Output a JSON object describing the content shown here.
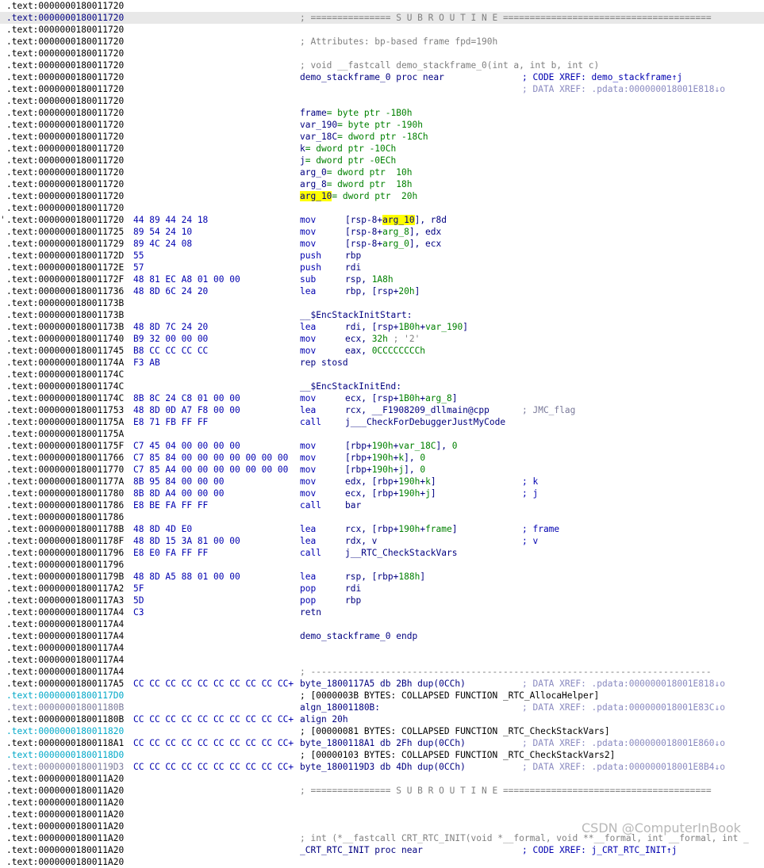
{
  "watermark": "CSDN @ComputerInBook",
  "lines": [
    {
      "addr": ".text:0000000180011720"
    },
    {
      "addr": ".text:0000000180011720",
      "addr_color": "navy",
      "highlight": true,
      "ins": [
        {
          "t": "; =============== S U B R O U T I N E =======================================",
          "c": "gray"
        }
      ]
    },
    {
      "addr": ".text:0000000180011720"
    },
    {
      "addr": ".text:0000000180011720",
      "ins": [
        {
          "t": "; Attributes: bp-based frame fpd=190h",
          "c": "gray"
        }
      ]
    },
    {
      "addr": ".text:0000000180011720"
    },
    {
      "addr": ".text:0000000180011720",
      "ins": [
        {
          "t": "; void __fastcall demo_stackframe_0(int a, int b, int c)",
          "c": "gray"
        }
      ]
    },
    {
      "addr": ".text:0000000180011720",
      "ins": [
        {
          "t": "demo_stackframe_0 proc near",
          "c": "navy"
        }
      ],
      "cmt": [
        {
          "t": "; CODE XREF: demo_stackframe↑j",
          "c": "blue"
        }
      ]
    },
    {
      "addr": ".text:0000000180011720",
      "cmt": [
        {
          "t": "; DATA XREF: .pdata:000000018001E818↓o",
          "c": "xref"
        }
      ]
    },
    {
      "addr": ".text:0000000180011720"
    },
    {
      "addr": ".text:0000000180011720",
      "ins": [
        {
          "t": "frame",
          "c": "navy"
        },
        {
          "t": "= byte ptr -1B0h",
          "c": "grn"
        }
      ]
    },
    {
      "addr": ".text:0000000180011720",
      "ins": [
        {
          "t": "var_190",
          "c": "navy"
        },
        {
          "t": "= byte ptr -190h",
          "c": "grn"
        }
      ]
    },
    {
      "addr": ".text:0000000180011720",
      "ins": [
        {
          "t": "var_18C",
          "c": "navy"
        },
        {
          "t": "= dword ptr -18Ch",
          "c": "grn"
        }
      ]
    },
    {
      "addr": ".text:0000000180011720",
      "ins": [
        {
          "t": "k",
          "c": "navy"
        },
        {
          "t": "= dword ptr -10Ch",
          "c": "grn"
        }
      ]
    },
    {
      "addr": ".text:0000000180011720",
      "ins": [
        {
          "t": "j",
          "c": "navy"
        },
        {
          "t": "= dword ptr -0ECh",
          "c": "grn"
        }
      ]
    },
    {
      "addr": ".text:0000000180011720",
      "ins": [
        {
          "t": "arg_0",
          "c": "navy"
        },
        {
          "t": "= dword ptr  10h",
          "c": "grn"
        }
      ]
    },
    {
      "addr": ".text:0000000180011720",
      "ins": [
        {
          "t": "arg_8",
          "c": "navy"
        },
        {
          "t": "= dword ptr  18h",
          "c": "grn"
        }
      ]
    },
    {
      "addr": ".text:0000000180011720",
      "ins": [
        {
          "t": "arg_10",
          "c": "navy",
          "mark": true
        },
        {
          "t": "= dword ptr  20h",
          "c": "grn"
        }
      ]
    },
    {
      "addr": ".text:0000000180011720"
    },
    {
      "addr": ".text:0000000180011720",
      "gut": "'",
      "bytes": "44 89 44 24 18",
      "mn": "mov",
      "ins": [
        {
          "t": "[rsp-8+",
          "c": "navy"
        },
        {
          "t": "arg_10",
          "c": "navy",
          "mark": true
        },
        {
          "t": "], r8d",
          "c": "navy"
        }
      ]
    },
    {
      "addr": ".text:0000000180011725",
      "bytes": "89 54 24 10",
      "mn": "mov",
      "ins": [
        {
          "t": "[rsp-8+",
          "c": "navy"
        },
        {
          "t": "arg_8",
          "c": "grn"
        },
        {
          "t": "], edx",
          "c": "navy"
        }
      ]
    },
    {
      "addr": ".text:0000000180011729",
      "bytes": "89 4C 24 08",
      "mn": "mov",
      "ins": [
        {
          "t": "[rsp-8+",
          "c": "navy"
        },
        {
          "t": "arg_0",
          "c": "grn"
        },
        {
          "t": "], ecx",
          "c": "navy"
        }
      ]
    },
    {
      "addr": ".text:000000018001172D",
      "bytes": "55",
      "mn": "push",
      "ins": [
        {
          "t": "rbp",
          "c": "navy"
        }
      ]
    },
    {
      "addr": ".text:000000018001172E",
      "bytes": "57",
      "mn": "push",
      "ins": [
        {
          "t": "rdi",
          "c": "navy"
        }
      ]
    },
    {
      "addr": ".text:000000018001172F",
      "bytes": "48 81 EC A8 01 00 00",
      "mn": "sub",
      "ins": [
        {
          "t": "rsp, ",
          "c": "navy"
        },
        {
          "t": "1A8h",
          "c": "grn"
        }
      ]
    },
    {
      "addr": ".text:0000000180011736",
      "bytes": "48 8D 6C 24 20",
      "mn": "lea",
      "ins": [
        {
          "t": "rbp, [rsp+",
          "c": "navy"
        },
        {
          "t": "20h",
          "c": "grn"
        },
        {
          "t": "]",
          "c": "navy"
        }
      ]
    },
    {
      "addr": ".text:000000018001173B"
    },
    {
      "addr": ".text:000000018001173B",
      "ins": [
        {
          "t": "__$EncStackInitStart:",
          "c": "navy"
        }
      ]
    },
    {
      "addr": ".text:000000018001173B",
      "bytes": "48 8D 7C 24 20",
      "mn": "lea",
      "ins": [
        {
          "t": "rdi, [rsp+",
          "c": "navy"
        },
        {
          "t": "1B0h",
          "c": "grn"
        },
        {
          "t": "+",
          "c": "navy"
        },
        {
          "t": "var_190",
          "c": "grn"
        },
        {
          "t": "]",
          "c": "navy"
        }
      ]
    },
    {
      "addr": ".text:0000000180011740",
      "bytes": "B9 32 00 00 00",
      "mn": "mov",
      "ins": [
        {
          "t": "ecx, ",
          "c": "navy"
        },
        {
          "t": "32h",
          "c": "grn"
        },
        {
          "t": " ; '2'",
          "c": "gray"
        }
      ]
    },
    {
      "addr": ".text:0000000180011745",
      "bytes": "B8 CC CC CC CC",
      "mn": "mov",
      "ins": [
        {
          "t": "eax, ",
          "c": "navy"
        },
        {
          "t": "0CCCCCCCCh",
          "c": "grn"
        }
      ]
    },
    {
      "addr": ".text:000000018001174A",
      "bytes": "F3 AB",
      "ins": [
        {
          "t": "rep stosd",
          "c": "navy"
        }
      ]
    },
    {
      "addr": ".text:000000018001174C"
    },
    {
      "addr": ".text:000000018001174C",
      "ins": [
        {
          "t": "__$EncStackInitEnd:",
          "c": "navy"
        }
      ]
    },
    {
      "addr": ".text:000000018001174C",
      "bytes": "8B 8C 24 C8 01 00 00",
      "mn": "mov",
      "ins": [
        {
          "t": "ecx, [rsp+",
          "c": "navy"
        },
        {
          "t": "1B0h",
          "c": "grn"
        },
        {
          "t": "+",
          "c": "navy"
        },
        {
          "t": "arg_8",
          "c": "grn"
        },
        {
          "t": "]",
          "c": "navy"
        }
      ]
    },
    {
      "addr": ".text:0000000180011753",
      "bytes": "48 8D 0D A7 F8 00 00",
      "mn": "lea",
      "ins": [
        {
          "t": "rcx, __F1908209_dllmain@cpp",
          "c": "navy"
        }
      ],
      "cmt": [
        {
          "t": "; JMC_flag",
          "c": "gx"
        }
      ]
    },
    {
      "addr": ".text:000000018001175A",
      "bytes": "E8 71 FB FF FF",
      "mn": "call",
      "ins": [
        {
          "t": "j___CheckForDebuggerJustMyCode",
          "c": "navy"
        }
      ]
    },
    {
      "addr": ".text:000000018001175A"
    },
    {
      "addr": ".text:000000018001175F",
      "bytes": "C7 45 04 00 00 00 00",
      "mn": "mov",
      "ins": [
        {
          "t": "[rbp+",
          "c": "navy"
        },
        {
          "t": "190h",
          "c": "grn"
        },
        {
          "t": "+",
          "c": "navy"
        },
        {
          "t": "var_18C",
          "c": "grn"
        },
        {
          "t": "], ",
          "c": "navy"
        },
        {
          "t": "0",
          "c": "grn"
        }
      ]
    },
    {
      "addr": ".text:0000000180011766",
      "bytes": "C7 85 84 00 00 00 00 00 00 00",
      "mn": "mov",
      "ins": [
        {
          "t": "[rbp+",
          "c": "navy"
        },
        {
          "t": "190h",
          "c": "grn"
        },
        {
          "t": "+",
          "c": "navy"
        },
        {
          "t": "k",
          "c": "grn"
        },
        {
          "t": "], ",
          "c": "navy"
        },
        {
          "t": "0",
          "c": "grn"
        }
      ]
    },
    {
      "addr": ".text:0000000180011770",
      "bytes": "C7 85 A4 00 00 00 00 00 00 00",
      "mn": "mov",
      "ins": [
        {
          "t": "[rbp+",
          "c": "navy"
        },
        {
          "t": "190h",
          "c": "grn"
        },
        {
          "t": "+",
          "c": "navy"
        },
        {
          "t": "j",
          "c": "grn"
        },
        {
          "t": "], ",
          "c": "navy"
        },
        {
          "t": "0",
          "c": "grn"
        }
      ]
    },
    {
      "addr": ".text:000000018001177A",
      "bytes": "8B 95 84 00 00 00",
      "mn": "mov",
      "ins": [
        {
          "t": "edx, [rbp+",
          "c": "navy"
        },
        {
          "t": "190h",
          "c": "grn"
        },
        {
          "t": "+",
          "c": "navy"
        },
        {
          "t": "k",
          "c": "grn"
        },
        {
          "t": "]",
          "c": "navy"
        }
      ],
      "cmt": [
        {
          "t": "; k",
          "c": "blue"
        }
      ]
    },
    {
      "addr": ".text:0000000180011780",
      "bytes": "8B 8D A4 00 00 00",
      "mn": "mov",
      "ins": [
        {
          "t": "ecx, [rbp+",
          "c": "navy"
        },
        {
          "t": "190h",
          "c": "grn"
        },
        {
          "t": "+",
          "c": "navy"
        },
        {
          "t": "j",
          "c": "grn"
        },
        {
          "t": "]",
          "c": "navy"
        }
      ],
      "cmt": [
        {
          "t": "; j",
          "c": "blue"
        }
      ]
    },
    {
      "addr": ".text:0000000180011786",
      "bytes": "E8 BE FA FF FF",
      "mn": "call",
      "ins": [
        {
          "t": "bar",
          "c": "navy"
        }
      ]
    },
    {
      "addr": ".text:0000000180011786"
    },
    {
      "addr": ".text:000000018001178B",
      "bytes": "48 8D 4D E0",
      "mn": "lea",
      "ins": [
        {
          "t": "rcx, [rbp+",
          "c": "navy"
        },
        {
          "t": "190h",
          "c": "grn"
        },
        {
          "t": "+",
          "c": "navy"
        },
        {
          "t": "frame",
          "c": "grn"
        },
        {
          "t": "]",
          "c": "navy"
        }
      ],
      "cmt": [
        {
          "t": "; frame",
          "c": "blue"
        }
      ]
    },
    {
      "addr": ".text:000000018001178F",
      "bytes": "48 8D 15 3A 81 00 00",
      "mn": "lea",
      "ins": [
        {
          "t": "rdx, v",
          "c": "navy"
        }
      ],
      "cmt": [
        {
          "t": "; v",
          "c": "blue"
        }
      ]
    },
    {
      "addr": ".text:0000000180011796",
      "bytes": "E8 E0 FA FF FF",
      "mn": "call",
      "ins": [
        {
          "t": "j__RTC_CheckStackVars",
          "c": "navy"
        }
      ]
    },
    {
      "addr": ".text:0000000180011796"
    },
    {
      "addr": ".text:000000018001179B",
      "bytes": "48 8D A5 88 01 00 00",
      "mn": "lea",
      "ins": [
        {
          "t": "rsp, [rbp+",
          "c": "navy"
        },
        {
          "t": "188h",
          "c": "grn"
        },
        {
          "t": "]",
          "c": "navy"
        }
      ]
    },
    {
      "addr": ".text:00000001800117A2",
      "bytes": "5F",
      "mn": "pop",
      "ins": [
        {
          "t": "rdi",
          "c": "navy"
        }
      ]
    },
    {
      "addr": ".text:00000001800117A3",
      "bytes": "5D",
      "mn": "pop",
      "ins": [
        {
          "t": "rbp",
          "c": "navy"
        }
      ]
    },
    {
      "addr": ".text:00000001800117A4",
      "bytes": "C3",
      "ins": [
        {
          "t": "retn",
          "c": "navy"
        }
      ]
    },
    {
      "addr": ".text:00000001800117A4"
    },
    {
      "addr": ".text:00000001800117A4",
      "ins": [
        {
          "t": "demo_stackframe_0 endp",
          "c": "navy"
        }
      ]
    },
    {
      "addr": ".text:00000001800117A4"
    },
    {
      "addr": ".text:00000001800117A4"
    },
    {
      "addr": ".text:00000001800117A4",
      "ins": [
        {
          "t": "; ---------------------------------------------------------------------------",
          "c": "gray"
        }
      ]
    },
    {
      "addr": ".text:00000001800117A5",
      "bytes": "CC CC CC CC CC CC CC CC CC CC+",
      "ins": [
        {
          "t": "byte_1800117A5 db 2Bh dup(0CCh)",
          "c": "navy"
        }
      ],
      "cmt": [
        {
          "t": "; DATA XREF: .pdata:000000018001E818↓o",
          "c": "xref"
        }
      ]
    },
    {
      "addr": ".text:00000001800117D0",
      "addr_color": "cyan",
      "ins": [
        {
          "t": "; [0000003B BYTES: COLLAPSED FUNCTION _RTC_AllocaHelper]",
          "c": "bl"
        }
      ]
    },
    {
      "addr": ".text:000000018001180B",
      "addr_color": "gx",
      "ins": [
        {
          "t": "algn_18001180B:",
          "c": "navy"
        }
      ],
      "cmt": [
        {
          "t": "; DATA XREF: .pdata:000000018001E83C↓o",
          "c": "xref"
        }
      ]
    },
    {
      "addr": ".text:000000018001180B",
      "bytes": "CC CC CC CC CC CC CC CC CC CC+",
      "ins": [
        {
          "t": "align 20h",
          "c": "navy"
        }
      ]
    },
    {
      "addr": ".text:0000000180011820",
      "addr_color": "cyan",
      "ins": [
        {
          "t": "; [00000081 BYTES: COLLAPSED FUNCTION _RTC_CheckStackVars]",
          "c": "bl"
        }
      ]
    },
    {
      "addr": ".text:00000001800118A1",
      "bytes": "CC CC CC CC CC CC CC CC CC CC+",
      "ins": [
        {
          "t": "byte_1800118A1 db 2Fh dup(0CCh)",
          "c": "navy"
        }
      ],
      "cmt": [
        {
          "t": "; DATA XREF: .pdata:000000018001E860↓o",
          "c": "xref"
        }
      ]
    },
    {
      "addr": ".text:00000001800118D0",
      "addr_color": "cyan",
      "ins": [
        {
          "t": "; [00000103 BYTES: COLLAPSED FUNCTION _RTC_CheckStackVars2]",
          "c": "bl"
        }
      ]
    },
    {
      "addr": ".text:00000001800119D3",
      "addr_color": "gx",
      "bytes": "CC CC CC CC CC CC CC CC CC CC+",
      "ins": [
        {
          "t": "byte_1800119D3 db 4Dh dup(0CCh)",
          "c": "navy"
        }
      ],
      "cmt": [
        {
          "t": "; DATA XREF: .pdata:000000018001E8B4↓o",
          "c": "xref"
        }
      ]
    },
    {
      "addr": ".text:0000000180011A20"
    },
    {
      "addr": ".text:0000000180011A20",
      "ins": [
        {
          "t": "; =============== S U B R O U T I N E =======================================",
          "c": "gray"
        }
      ]
    },
    {
      "addr": ".text:0000000180011A20"
    },
    {
      "addr": ".text:0000000180011A20"
    },
    {
      "addr": ".text:0000000180011A20"
    },
    {
      "addr": ".text:0000000180011A20",
      "ins": [
        {
          "t": "; int (*__fastcall CRT_RTC_INIT(void *__formal, void **__formal, int __formal, int _",
          "c": "gray"
        }
      ]
    },
    {
      "addr": ".text:0000000180011A20",
      "ins": [
        {
          "t": "_CRT_RTC_INIT proc near",
          "c": "navy"
        }
      ],
      "cmt": [
        {
          "t": "; CODE XREF: j_CRT_RTC_INIT↑j",
          "c": "blue"
        }
      ]
    },
    {
      "addr": ".text:0000000180011A20"
    }
  ]
}
